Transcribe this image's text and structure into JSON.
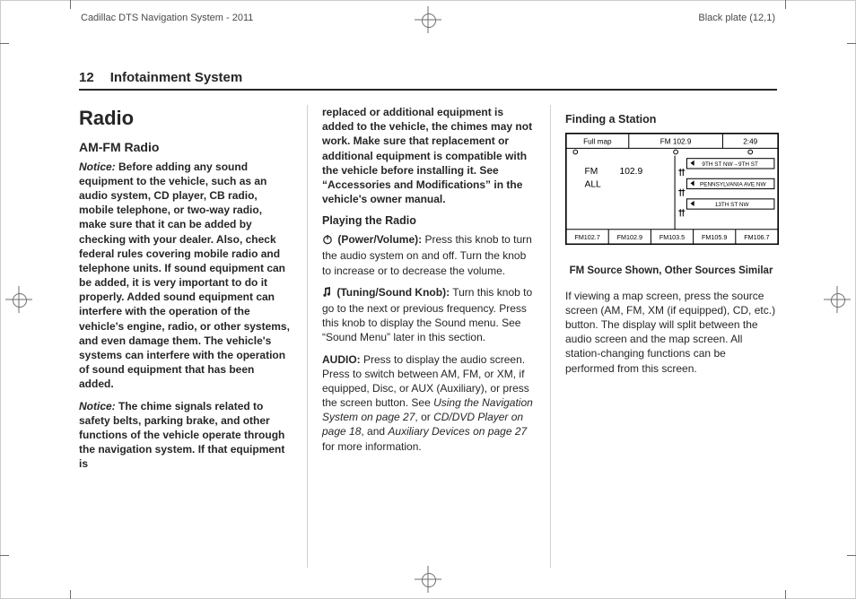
{
  "meta": {
    "doc_title": "Cadillac DTS Navigation System - 2011",
    "plate": "Black plate (12,1)"
  },
  "page": {
    "number": "12",
    "running_title": "Infotainment System"
  },
  "col1": {
    "h1": "Radio",
    "h2": "AM-FM Radio",
    "notice_label_1": "Notice:",
    "notice_1": " Before adding any sound equipment to the vehicle, such as an audio system, CD player, CB radio, mobile telephone, or two-way radio, make sure that it can be added by checking with your dealer. Also, check federal rules covering mobile radio and telephone units. If sound equipment can be added, it is very important to do it properly. Added sound equipment can interfere with the operation of the vehicle's engine, radio, or other systems, and even damage them. The vehicle's systems can interfere with the operation of sound equipment that has been added.",
    "notice_label_2": "Notice:",
    "notice_2": " The chime signals related to safety belts, parking brake, and other functions of the vehicle operate through the navigation system. If that equipment is"
  },
  "col2": {
    "cont": "replaced or additional equipment is added to the vehicle, the chimes may not work. Make sure that replacement or additional equipment is compatible with the vehicle before installing it. See “Accessories and Modifications” in the vehicle's owner manual.",
    "h_playing": "Playing the Radio",
    "power_label": " (Power/Volume):",
    "power_text": " Press this knob to turn the audio system on and off. Turn the knob to increase or to decrease the volume.",
    "tune_label": " (Tuning/Sound Knob):",
    "tune_text": " Turn this knob to go to the next or previous frequency. Press this knob to display the Sound menu. See “Sound Menu” later in this section.",
    "audio_label": "AUDIO:",
    "audio_text_1": " Press to display the audio screen. Press to switch between AM, FM, or XM, if equipped, Disc, or AUX (Auxiliary), or press the screen button. See ",
    "audio_ref_1": "Using the Navigation System on page 27",
    "audio_join_1": ", or ",
    "audio_ref_2": "CD/DVD Player on page 18",
    "audio_join_2": ", and ",
    "audio_ref_3": "Auxiliary Devices on page 27",
    "audio_tail": " for more information."
  },
  "col3": {
    "h_finding": "Finding a Station",
    "fig": {
      "top_left": "Full map",
      "top_mid": "FM 102.9",
      "top_right": "2:49",
      "band": "FM",
      "scope": "ALL",
      "freq": "102.9",
      "row1": "9TH ST NW→9TH ST",
      "row2": "PENNSYLVANIA AVE NW",
      "row3": "13TH ST NW",
      "p1": "FM102.7",
      "p2": "FM102.9",
      "p3": "FM103.5",
      "p4": "FM105.9",
      "p5": "FM106.7"
    },
    "caption": "FM Source Shown, Other Sources Similar",
    "para": "If viewing a map screen, press the source screen (AM, FM, XM (if equipped), CD, etc.) button. The display will split between the audio screen and the map screen. All station-changing functions can be performed from this screen."
  }
}
